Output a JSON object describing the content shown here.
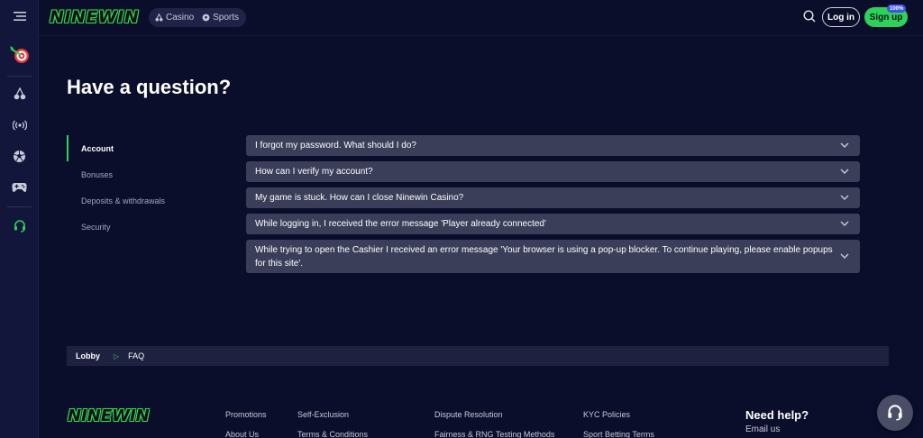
{
  "header": {
    "logo": "NINEWIN",
    "nav": [
      {
        "label": "Casino",
        "icon": "cherries-icon"
      },
      {
        "label": "Sports",
        "icon": "soccer-ball-icon"
      }
    ],
    "login_label": "Log in",
    "signup_label": "Sign up",
    "signup_badge": "100%"
  },
  "sidebar": {
    "items": [
      "menu-icon",
      "dart-target-icon",
      "cherries-icon",
      "live-broadcast-icon",
      "soccer-ball-icon",
      "gamepad-icon",
      "headset-icon"
    ]
  },
  "page": {
    "title": "Have a question?"
  },
  "categories": [
    {
      "label": "Account",
      "active": true
    },
    {
      "label": "Bonuses",
      "active": false
    },
    {
      "label": "Deposits & withdrawals",
      "active": false
    },
    {
      "label": "Security",
      "active": false
    }
  ],
  "faq": [
    {
      "question": "I forgot my password. What should I do?"
    },
    {
      "question": "How can I verify my account?"
    },
    {
      "question": "My game is stuck. How can I close Ninewin Casino?"
    },
    {
      "question": "While logging in, I received the error message 'Player already connected'"
    },
    {
      "question": "While trying to open the Cashier I received an error message 'Your browser is using a pop-up blocker. To continue playing, please enable popups for this site'."
    }
  ],
  "breadcrumb": {
    "lobby": "Lobby",
    "separator": "▷",
    "current": "FAQ"
  },
  "footer": {
    "logo": "NINEWIN",
    "links": {
      "promotions": "Promotions",
      "about_us": "About Us",
      "self_exclusion": "Self-Exclusion",
      "terms": "Terms & Conditions",
      "dispute": "Dispute Resolution",
      "fairness": "Fairness & RNG Testing Methods",
      "kyc": "KYC Policies",
      "sport_terms": "Sport Betting Terms"
    },
    "need_help": "Need help?",
    "email_us": "Email us"
  },
  "colors": {
    "background": "#0b0e2b",
    "sidebar": "#12163a",
    "accent_green": "#2ed15a",
    "faq_row": "#3b3e59",
    "breadcrumb_bg": "#1e2140"
  }
}
